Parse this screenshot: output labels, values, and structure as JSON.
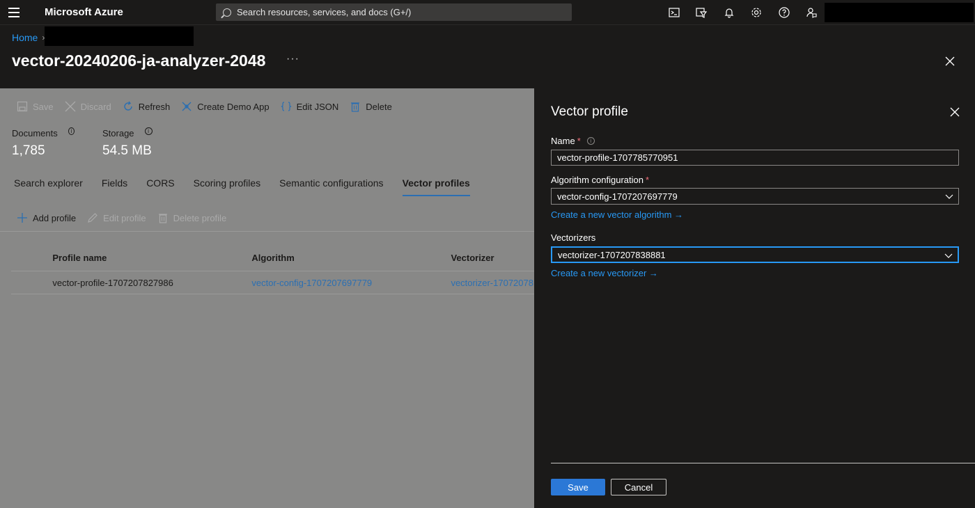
{
  "topbar": {
    "brand": "Microsoft Azure",
    "search_placeholder": "Search resources, services, and docs (G+/)",
    "icons": [
      "cloud-shell-icon",
      "directory-filter-icon",
      "notifications-icon",
      "settings-icon",
      "help-icon",
      "feedback-icon"
    ]
  },
  "header": {
    "breadcrumb_home": "Home",
    "breadcrumb_sep": "›",
    "title": "vector-20240206-ja-analyzer-2048",
    "more": "···"
  },
  "toolbar": {
    "save": "Save",
    "discard": "Discard",
    "refresh": "Refresh",
    "create_demo_app": "Create Demo App",
    "edit_json": "Edit JSON",
    "delete": "Delete"
  },
  "stats": {
    "documents_label": "Documents",
    "documents_value": "1,785",
    "storage_label": "Storage",
    "storage_value": "54.5 MB",
    "info": "i"
  },
  "tabs": [
    "Search explorer",
    "Fields",
    "CORS",
    "Scoring profiles",
    "Semantic configurations",
    "Vector profiles"
  ],
  "active_tab": "Vector profiles",
  "subtoolbar": {
    "add_profile": "Add profile",
    "edit_profile": "Edit profile",
    "delete_profile": "Delete profile"
  },
  "table": {
    "headers": [
      "Profile name",
      "Algorithm",
      "Vectorizer"
    ],
    "rows": [
      {
        "profile_name": "vector-profile-1707207827986",
        "algorithm": "vector-config-1707207697779",
        "vectorizer": "vectorizer-17072078"
      }
    ]
  },
  "panel": {
    "title": "Vector profile",
    "name_label": "Name",
    "required_mark": "*",
    "info": "i",
    "name_value": "vector-profile-1707785770951",
    "algorithm_label": "Algorithm configuration",
    "algorithm_value": "vector-config-1707207697779",
    "create_algorithm_link": "Create a new vector algorithm →",
    "vectorizers_label": "Vectorizers",
    "vectorizer_value": "vectorizer-1707207838881",
    "create_vectorizer_link": "Create a new vectorizer →",
    "save": "Save",
    "cancel": "Cancel"
  }
}
